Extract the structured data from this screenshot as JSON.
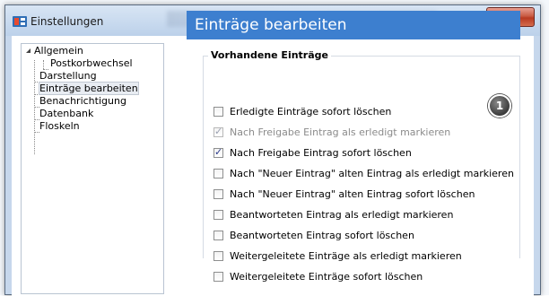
{
  "window": {
    "title": "Einstellungen"
  },
  "tree": {
    "items": [
      {
        "label": "Allgemein"
      },
      {
        "label": "Postkorbwechsel"
      },
      {
        "label": "Darstellung"
      },
      {
        "label": "Einträge bearbeiten"
      },
      {
        "label": "Benachrichtigung"
      },
      {
        "label": "Datenbank"
      },
      {
        "label": "Floskeln"
      }
    ]
  },
  "panel": {
    "header": "Einträge bearbeiten",
    "group_title": "Vorhandene Einträge",
    "badge": "1",
    "options": [
      {
        "label": "Erledigte Einträge sofort löschen",
        "checked": false,
        "disabled": false
      },
      {
        "label": "Nach Freigabe Eintrag als erledigt markieren",
        "checked": true,
        "disabled": true
      },
      {
        "label": "Nach Freigabe Eintrag sofort löschen",
        "checked": true,
        "disabled": false
      },
      {
        "label": "Nach \"Neuer Eintrag\" alten Eintrag als erledigt markieren",
        "checked": false,
        "disabled": false
      },
      {
        "label": "Nach \"Neuer Eintrag\" alten Eintrag sofort löschen",
        "checked": false,
        "disabled": false
      },
      {
        "label": "Beantworteten Eintrag als erledigt markieren",
        "checked": false,
        "disabled": false
      },
      {
        "label": "Beantworteten Eintrag sofort löschen",
        "checked": false,
        "disabled": false
      },
      {
        "label": "Weitergeleitete Einträge als erledigt markieren",
        "checked": false,
        "disabled": false
      },
      {
        "label": "Weitergeleitete Einträge sofort löschen",
        "checked": false,
        "disabled": false
      }
    ]
  },
  "colors": {
    "header_bg": "#3d7fcf",
    "close_button": "#c85a43"
  }
}
